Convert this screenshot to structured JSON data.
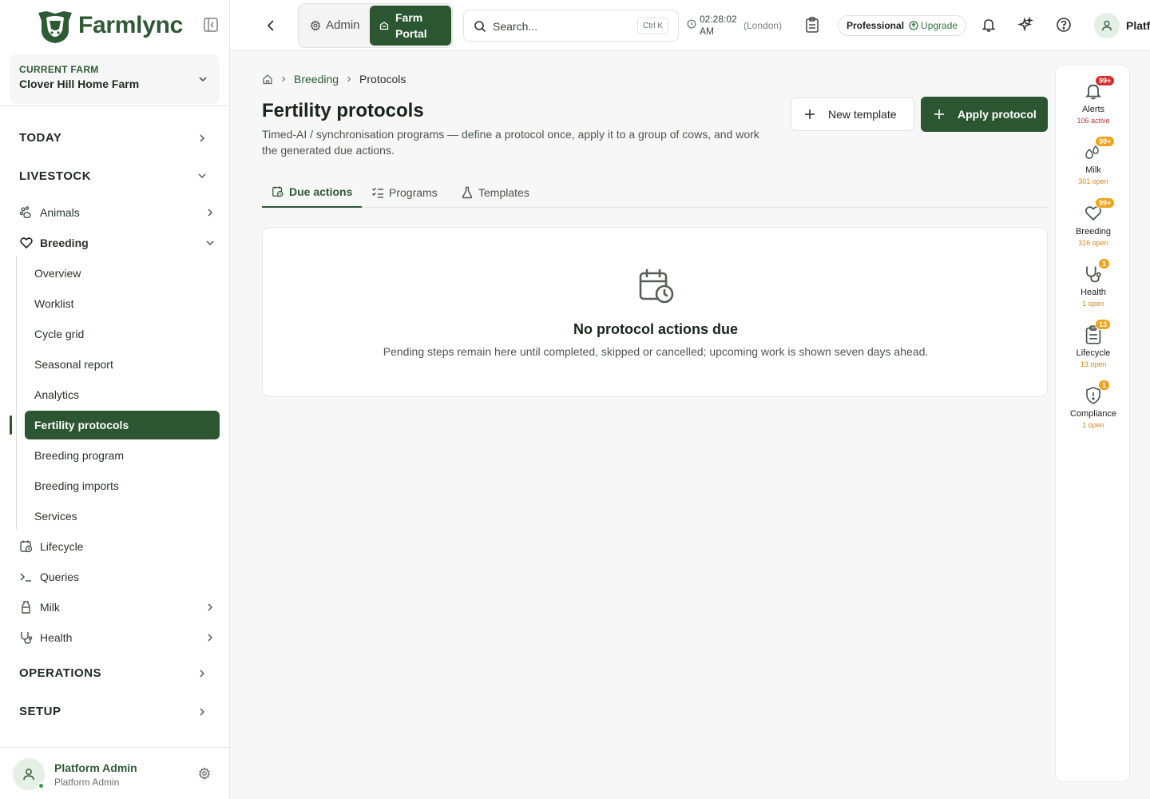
{
  "brand": {
    "name": "Farmlync"
  },
  "farm": {
    "label": "CURRENT FARM",
    "name": "Clover Hill Home Farm"
  },
  "nav": {
    "today": "TODAY",
    "livestock": "LIVESTOCK",
    "operations": "OPERATIONS",
    "setup": "SETUP",
    "animals": "Animals",
    "breeding": "Breeding",
    "breeding_sub": [
      "Overview",
      "Worklist",
      "Cycle grid",
      "Seasonal report",
      "Analytics",
      "Fertility protocols",
      "Breeding program",
      "Breeding imports",
      "Services"
    ],
    "lifecycle": "Lifecycle",
    "queries": "Queries",
    "milk": "Milk",
    "health": "Health"
  },
  "user": {
    "name": "Platform Admin",
    "role": "Platform Admin",
    "topbar_name": "Platf"
  },
  "topbar": {
    "admin": "Admin",
    "farm_portal": "Farm Portal",
    "search_placeholder": "Search...",
    "search_kbd": "Ctrl K",
    "time": "02:28:02",
    "ampm": "AM",
    "tz": "(London)",
    "plan": "Professional",
    "upgrade": "Upgrade"
  },
  "breadcrumb": {
    "section": "Breeding",
    "current": "Protocols"
  },
  "page": {
    "title": "Fertility protocols",
    "description": "Timed-AI / synchronisation programs — define a protocol once, apply it to a group of cows, and work the generated due actions.",
    "new_template": "New template",
    "apply_protocol": "Apply protocol"
  },
  "tabs": [
    "Due actions",
    "Programs",
    "Templates"
  ],
  "empty": {
    "title": "No protocol actions due",
    "desc": "Pending steps remain here until completed, skipped or cancelled; upcoming work is shown seven days ahead."
  },
  "rail": [
    {
      "label": "Alerts",
      "badge": "99+",
      "status": "106 active",
      "color": "#d92d2d"
    },
    {
      "label": "Milk",
      "badge": "99+",
      "status": "301 open",
      "color": "#e0820c"
    },
    {
      "label": "Breeding",
      "badge": "99+",
      "status": "316 open",
      "color": "#e0820c"
    },
    {
      "label": "Health",
      "badge": "1",
      "status": "1 open",
      "color": "#e0820c"
    },
    {
      "label": "Lifecycle",
      "badge": "13",
      "status": "13 open",
      "color": "#e0820c"
    },
    {
      "label": "Compliance",
      "badge": "1",
      "status": "1 open",
      "color": "#e0820c"
    }
  ],
  "colors": {
    "primary": "#2c5631",
    "alert": "#d92d2d",
    "warn": "#f0a21a"
  }
}
